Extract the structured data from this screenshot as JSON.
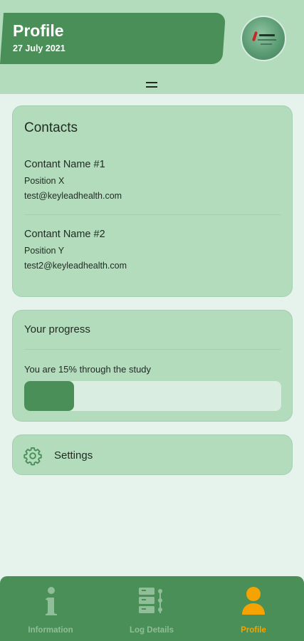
{
  "header": {
    "title": "Profile",
    "date": "27 July 2021"
  },
  "contacts": {
    "title": "Contacts",
    "items": [
      {
        "name": "Contant Name #1",
        "position": "Position X",
        "email": "test@keyleadhealth.com"
      },
      {
        "name": "Contant Name #2",
        "position": "Position Y",
        "email": "test2@keyleadhealth.com"
      }
    ]
  },
  "progress": {
    "title": "Your progress",
    "text": "You are 15% through the study",
    "percent": 15
  },
  "settings": {
    "label": "Settings",
    "icon": "gear-icon"
  },
  "nav": {
    "items": [
      {
        "label": "Information",
        "icon": "info-icon",
        "active": false
      },
      {
        "label": "Log Details",
        "icon": "log-icon",
        "active": false
      },
      {
        "label": "Profile",
        "icon": "person-icon",
        "active": true
      }
    ]
  },
  "colors": {
    "primary": "#4a8f57",
    "surface": "#b2dcbc",
    "background": "#e6f2ec",
    "active": "#f5a300",
    "inactive": "#8fbe99"
  }
}
